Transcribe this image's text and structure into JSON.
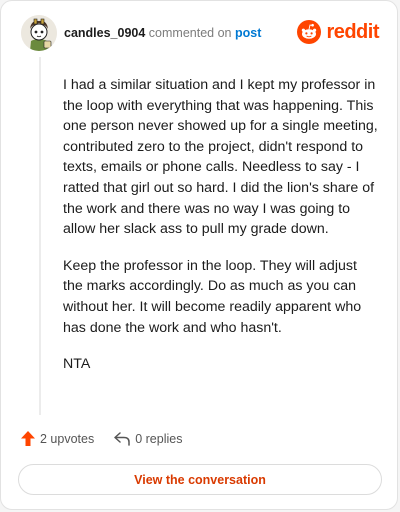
{
  "comment": {
    "username": "candles_0904",
    "action_text": "commented on",
    "post_link_label": "post",
    "paragraphs": [
      "I had a similar situation and I kept my professor in the loop with everything that was happening. This one person never showed up for a single meeting, contributed zero to the project, didn't respond to texts, emails or phone calls. Needless to say - I ratted that girl out so hard. I did the lion's share of the work and there was no way I was going to allow her slack ass to pull my grade down.",
      "Keep the professor in the loop. They will adjust the marks accordingly. Do as much as you can without her. It will become readily apparent who has done the work and who hasn't.",
      "NTA"
    ],
    "upvotes_label": "2 upvotes",
    "replies_label": "0 replies"
  },
  "brand": {
    "name": "reddit",
    "color": "#ff4500"
  },
  "footer": {
    "view_conversation_label": "View the conversation"
  },
  "icons": {
    "avatar": "snoo-avatar",
    "brand": "reddit-logo-icon",
    "upvote": "upvote-arrow-icon",
    "reply": "reply-arrow-icon"
  },
  "colors": {
    "accent": "#ff4500",
    "link": "#0079d3",
    "button_text": "#d93a00"
  }
}
